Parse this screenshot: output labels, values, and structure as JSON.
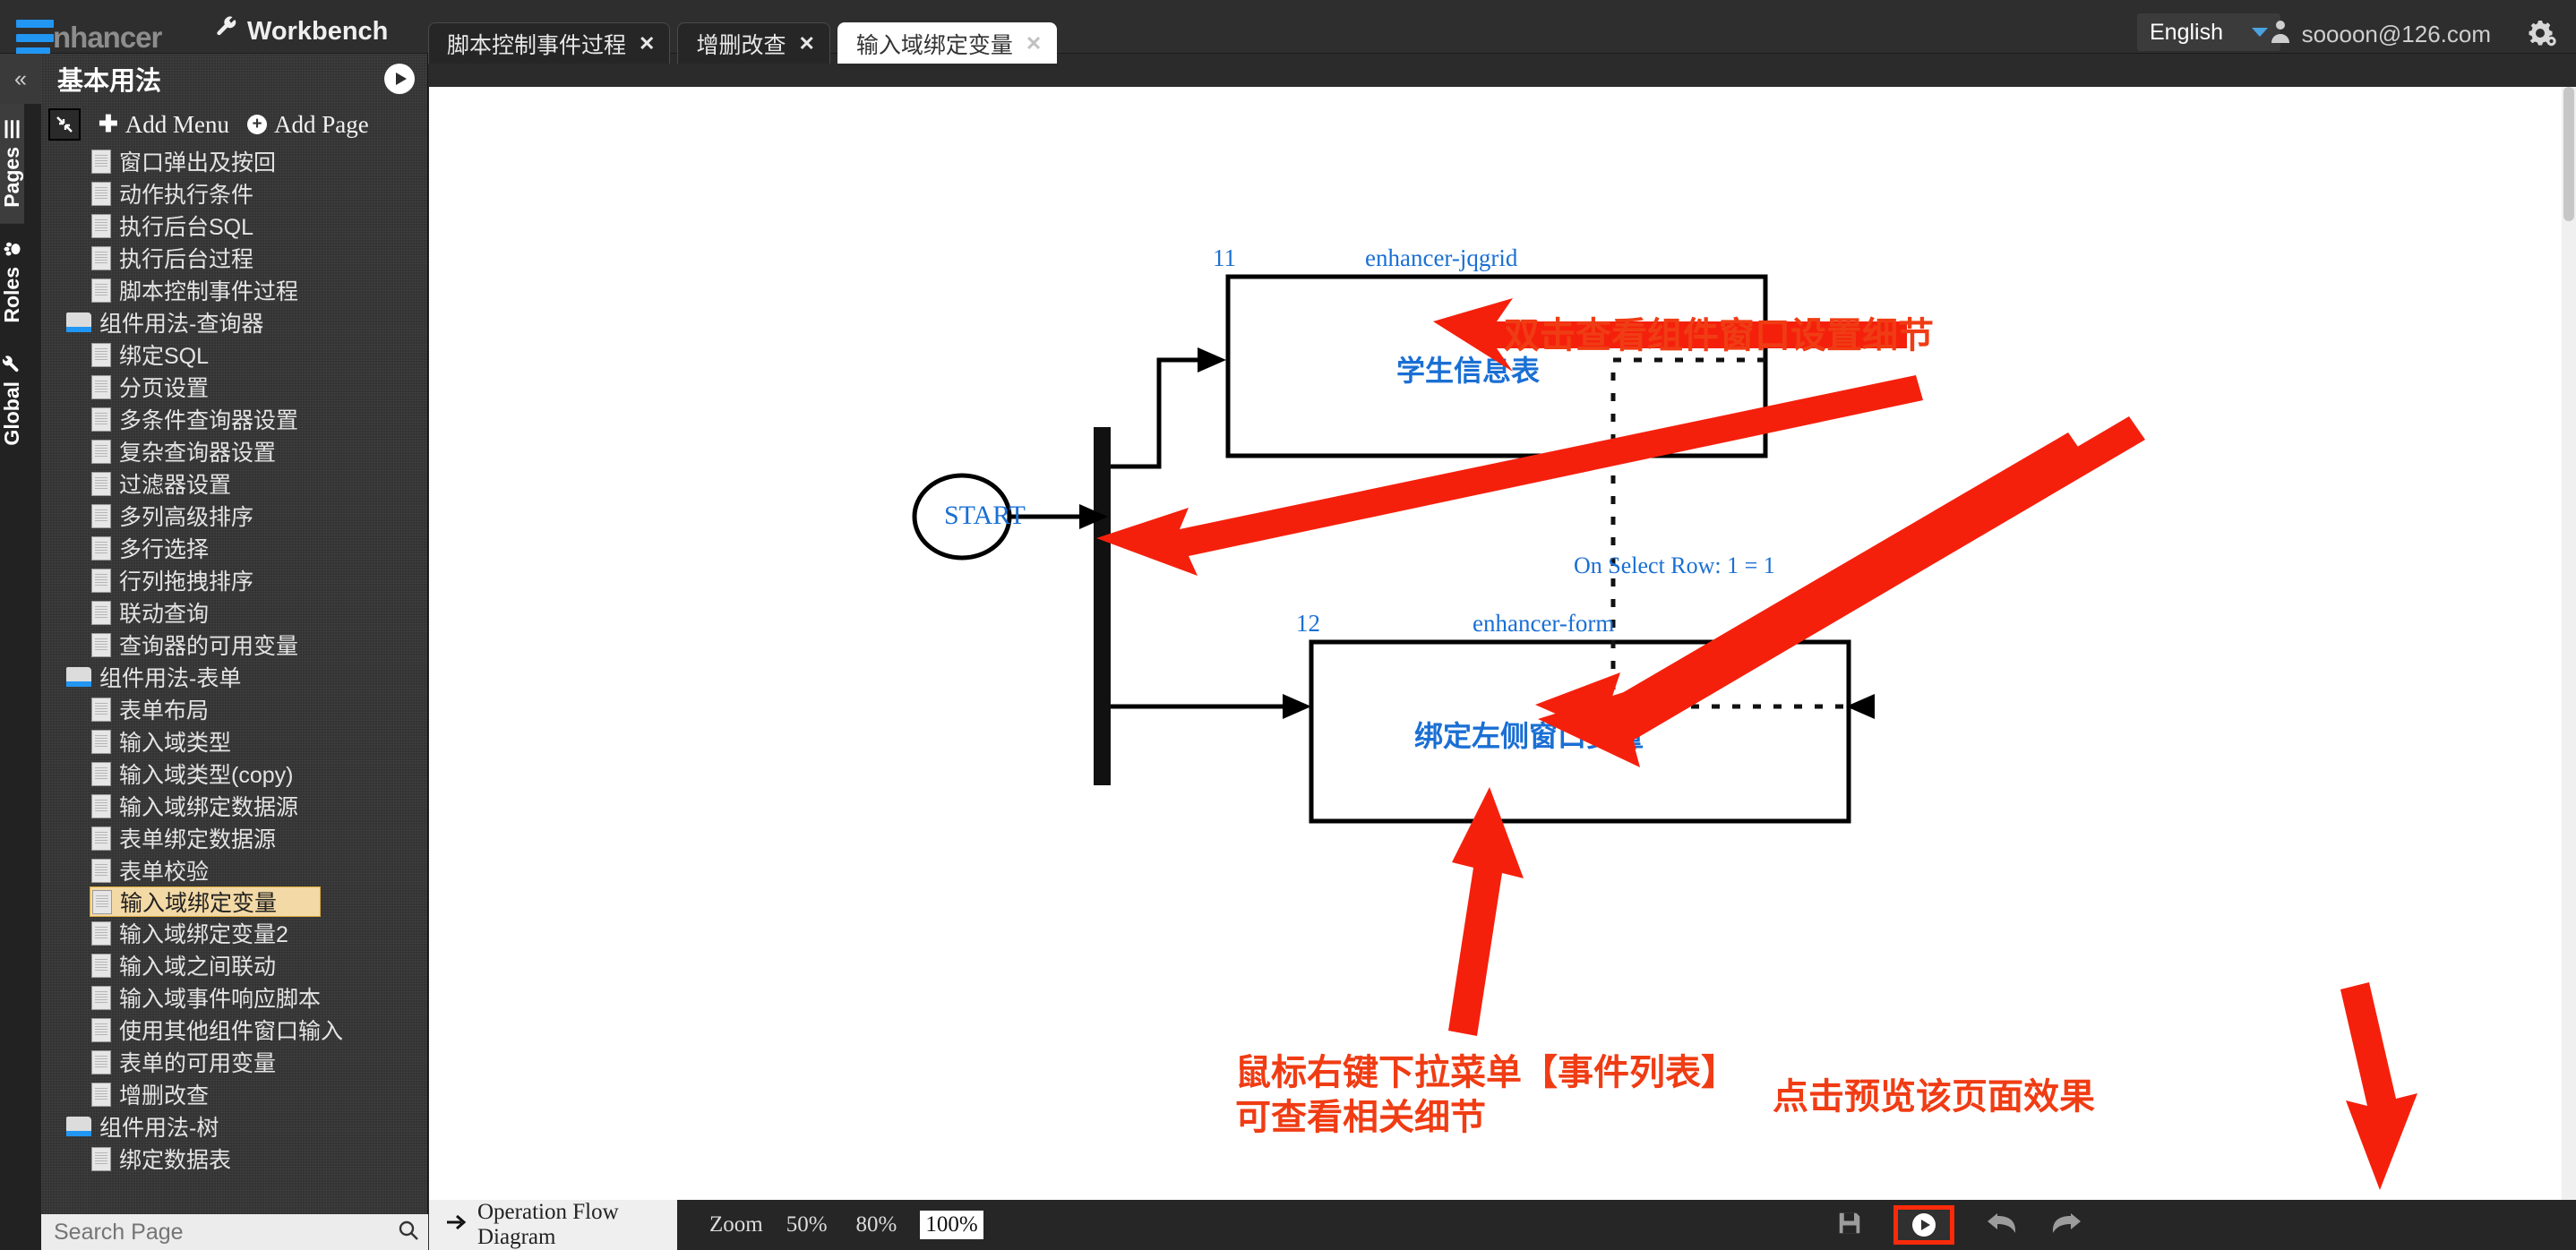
{
  "app": {
    "brand": "nhancer",
    "workbench_label": "Workbench"
  },
  "tabs": [
    {
      "label": "脚本控制事件过程",
      "close": "✕",
      "active": false
    },
    {
      "label": "增删改查",
      "close": "✕",
      "active": false
    },
    {
      "label": "输入域绑定变量",
      "close": "✕",
      "active": true
    }
  ],
  "header": {
    "language": "English",
    "user_email": "soooon@126.com",
    "gear_icon": "gear-icon",
    "user_icon": "user-icon",
    "caret_icon": "chevron-down-icon"
  },
  "rail": {
    "collapse": "«",
    "items": [
      {
        "label": "Pages",
        "icon": "list-icon",
        "selected": true
      },
      {
        "label": "Roles",
        "icon": "paw-icon",
        "selected": false
      },
      {
        "label": "Global",
        "icon": "wrench-icon",
        "selected": false
      }
    ]
  },
  "sidebar": {
    "title": "基本用法",
    "play_icon": "play-circle-icon",
    "collapse_icon": "collapse-arrows-icon",
    "add_menu": "Add Menu",
    "add_page": "Add Page",
    "search_placeholder": "Search Page",
    "search_icon": "search-icon",
    "tree": [
      {
        "label": "窗口弹出及按回",
        "type": "page"
      },
      {
        "label": "动作执行条件",
        "type": "page"
      },
      {
        "label": "执行后台SQL",
        "type": "page"
      },
      {
        "label": "执行后台过程",
        "type": "page"
      },
      {
        "label": "脚本控制事件过程",
        "type": "page"
      },
      {
        "label": "组件用法-查询器",
        "type": "folder"
      },
      {
        "label": "绑定SQL",
        "type": "page"
      },
      {
        "label": "分页设置",
        "type": "page"
      },
      {
        "label": "多条件查询器设置",
        "type": "page"
      },
      {
        "label": "复杂查询器设置",
        "type": "page"
      },
      {
        "label": "过滤器设置",
        "type": "page"
      },
      {
        "label": "多列高级排序",
        "type": "page"
      },
      {
        "label": "多行选择",
        "type": "page"
      },
      {
        "label": "行列拖拽排序",
        "type": "page"
      },
      {
        "label": "联动查询",
        "type": "page"
      },
      {
        "label": "查询器的可用变量",
        "type": "page"
      },
      {
        "label": "组件用法-表单",
        "type": "folder"
      },
      {
        "label": "表单布局",
        "type": "page"
      },
      {
        "label": "输入域类型",
        "type": "page"
      },
      {
        "label": "输入域类型(copy)",
        "type": "page"
      },
      {
        "label": "输入域绑定数据源",
        "type": "page"
      },
      {
        "label": "表单绑定数据源",
        "type": "page"
      },
      {
        "label": "表单校验",
        "type": "page"
      },
      {
        "label": "输入域绑定变量",
        "type": "page",
        "selected": true
      },
      {
        "label": "输入域绑定变量2",
        "type": "page"
      },
      {
        "label": "输入域之间联动",
        "type": "page"
      },
      {
        "label": "输入域事件响应脚本",
        "type": "page"
      },
      {
        "label": "使用其他组件窗口输入",
        "type": "page"
      },
      {
        "label": "表单的可用变量",
        "type": "page"
      },
      {
        "label": "增删改查",
        "type": "page"
      },
      {
        "label": "组件用法-树",
        "type": "folder"
      },
      {
        "label": "绑定数据表",
        "type": "page"
      }
    ]
  },
  "diagram": {
    "start_label": "START",
    "nodes": [
      {
        "id": "11",
        "type_label": "enhancer-jqgrid",
        "title": "学生信息表"
      },
      {
        "id": "12",
        "type_label": "enhancer-form",
        "title": "绑定左侧窗口变量"
      }
    ],
    "edge_label": "On Select Row: 1 = 1",
    "annotations": [
      {
        "name": "annotation-double-click",
        "text": "双击查看组件窗口设置细节"
      },
      {
        "name": "annotation-right-click",
        "text": "鼠标右键下拉菜单【事件列表】\n可查看相关细节"
      },
      {
        "name": "annotation-preview",
        "text": "点击预览该页面效果"
      }
    ]
  },
  "bottom": {
    "flow_tab": "Operation Flow Diagram",
    "flow_tab_icon": "arrow-right-icon",
    "zoom_label": "Zoom",
    "zoom_options": [
      "50%",
      "80%",
      "100%"
    ],
    "zoom_selected": "100%",
    "save_icon": "save-icon",
    "preview_icon": "play-icon",
    "undo_icon": "undo-icon",
    "redo_icon": "redo-icon"
  },
  "colors": {
    "accent_blue": "#1a6fd4",
    "annotation_red": "#f03c14",
    "selection_tan": "#f3d9a5",
    "brand_blue": "#2196f3"
  }
}
